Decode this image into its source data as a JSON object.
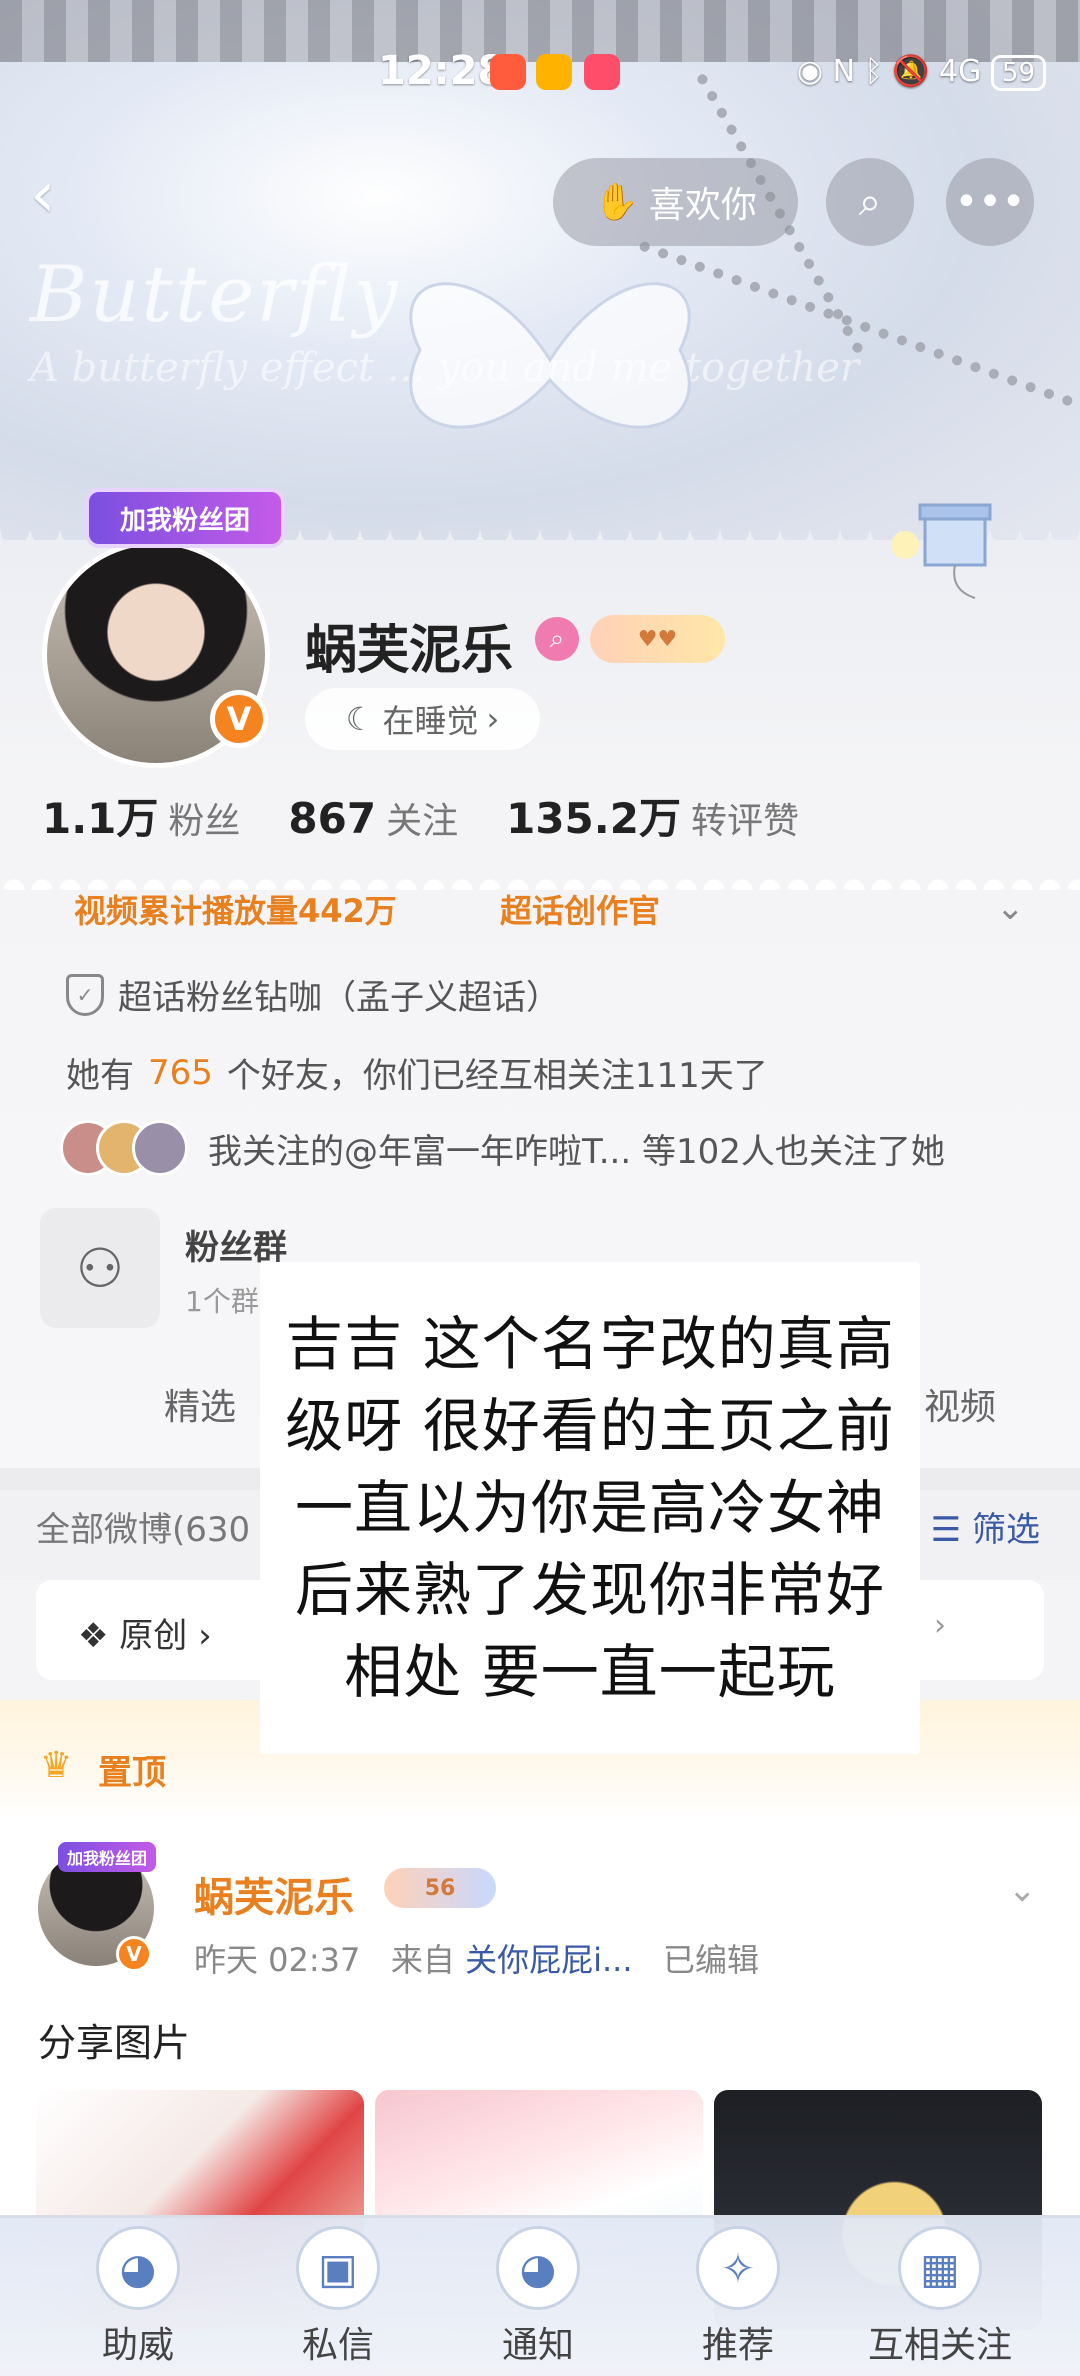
{
  "status_bar": {
    "time": "12:28",
    "battery": "59",
    "signal": "4G"
  },
  "top_nav": {
    "like_label": "喜欢你"
  },
  "banner": {
    "script_line1": "Butterfly",
    "script_line2": "A butterfly effect ... you and me together"
  },
  "profile": {
    "fan_badge": "加我粉丝团",
    "verified_mark": "V",
    "username": "蜗芙泥乐",
    "status": "在睡觉",
    "stats": [
      {
        "num": "1.1万",
        "label": "粉丝"
      },
      {
        "num": "867",
        "label": "关注"
      },
      {
        "num": "135.2万",
        "label": "转评赞"
      }
    ],
    "tags": [
      "视频累计播放量442万",
      "超话创作官"
    ],
    "super_topic": "超话粉丝钻咖（孟子义超话）",
    "friends_prefix": "她有",
    "friends_count": "765",
    "friends_suffix": "个好友，你们已经互相关注111天了",
    "mutual": "我关注的@年富一年咋啦T... 等102人也关注了她"
  },
  "fan_group": {
    "title": "粉丝群",
    "sub": "1个群"
  },
  "tabs": {
    "left": "精选",
    "right": "视频"
  },
  "weibo": {
    "all_label": "全部微博(630",
    "filter_label": "筛选",
    "original_label": "原创"
  },
  "pinned": {
    "label": "置顶"
  },
  "post": {
    "avatar_badge": "加我粉丝团",
    "name": "蜗芙泥乐",
    "level": "56",
    "time": "昨天 02:37",
    "from_prefix": "来自",
    "source": "关你屁屁i...",
    "edited": "已编辑",
    "text": "分享图片"
  },
  "overlay_text": "吉吉 这个名字改的真高级呀 很好看的主页之前一直以为你是高冷女神 后来熟了发现你非常好相处 要一直一起玩",
  "bottom_nav": [
    {
      "label": "助威",
      "icon": "dog-icon"
    },
    {
      "label": "私信",
      "icon": "gift-icon"
    },
    {
      "label": "通知",
      "icon": "dog-icon"
    },
    {
      "label": "推荐",
      "icon": "globe-icon"
    },
    {
      "label": "互相关注",
      "icon": "box-icon"
    }
  ]
}
